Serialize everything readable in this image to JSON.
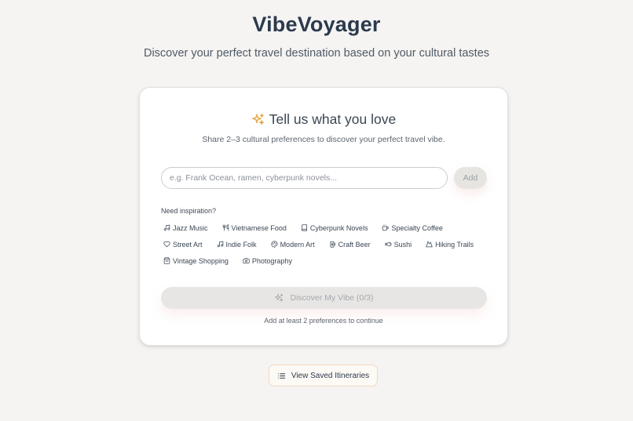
{
  "app": {
    "title": "VibeVoyager",
    "subtitle": "Discover your perfect travel destination based on your cultural tastes"
  },
  "card": {
    "heading": "Tell us what you love",
    "description": "Share 2–3 cultural preferences to discover your perfect travel vibe.",
    "input_value": "",
    "input_placeholder": "e.g. Frank Ocean, ramen, cyberpunk novels...",
    "add_label": "Add",
    "inspiration_label": "Need inspiration?",
    "discover_label": "Discover My Vibe (0/3)",
    "helper_text": "Add at least 2 preferences to continue"
  },
  "suggestions": [
    {
      "label": "Jazz Music",
      "icon": "music-note-icon"
    },
    {
      "label": "Vietnamese Food",
      "icon": "utensils-icon"
    },
    {
      "label": "Cyberpunk Novels",
      "icon": "book-icon"
    },
    {
      "label": "Specialty Coffee",
      "icon": "coffee-icon"
    },
    {
      "label": "Street Art",
      "icon": "heart-icon"
    },
    {
      "label": "Indie Folk",
      "icon": "music-note-icon"
    },
    {
      "label": "Modern Art",
      "icon": "palette-icon"
    },
    {
      "label": "Craft Beer",
      "icon": "beer-icon"
    },
    {
      "label": "Sushi",
      "icon": "fish-icon"
    },
    {
      "label": "Hiking Trails",
      "icon": "mountain-icon"
    },
    {
      "label": "Vintage Shopping",
      "icon": "shopping-bag-icon"
    },
    {
      "label": "Photography",
      "icon": "camera-icon"
    }
  ],
  "footer": {
    "saved_label": "View Saved Itineraries"
  },
  "colors": {
    "background": "#f5f4f2",
    "accent_sparkle": "#e8a33d",
    "title": "#2c3a4e",
    "disabled_button": "#e8e6e4"
  }
}
